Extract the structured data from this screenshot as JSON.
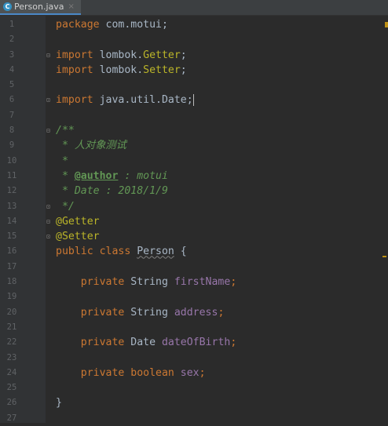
{
  "tab": {
    "filename": "Person.java",
    "icon_letter": "C",
    "close": "×"
  },
  "lines": [
    {
      "n": "1",
      "fold": "",
      "parts": [
        [
          "kw",
          "package "
        ],
        [
          "ident",
          "com.motui;"
        ]
      ]
    },
    {
      "n": "2",
      "fold": "",
      "parts": []
    },
    {
      "n": "3",
      "fold": "⊟",
      "parts": [
        [
          "kw",
          "import "
        ],
        [
          "ident",
          "lombok."
        ],
        [
          "ann",
          "Getter"
        ],
        [
          "ident",
          ";"
        ]
      ]
    },
    {
      "n": "4",
      "fold": "",
      "parts": [
        [
          "kw",
          "import "
        ],
        [
          "ident",
          "lombok."
        ],
        [
          "ann",
          "Setter"
        ],
        [
          "ident",
          ";"
        ]
      ]
    },
    {
      "n": "5",
      "fold": "",
      "parts": []
    },
    {
      "n": "6",
      "fold": "⊡",
      "parts": [
        [
          "kw",
          "import "
        ],
        [
          "ident",
          "java.util.Date"
        ],
        [
          "ident",
          ";"
        ]
      ],
      "caret": true
    },
    {
      "n": "7",
      "fold": "",
      "parts": []
    },
    {
      "n": "8",
      "fold": "⊟",
      "parts": [
        [
          "doc",
          "/**"
        ]
      ]
    },
    {
      "n": "9",
      "fold": "",
      "parts": [
        [
          "doc",
          " * 人对象测试"
        ]
      ]
    },
    {
      "n": "10",
      "fold": "",
      "parts": [
        [
          "doc",
          " *"
        ]
      ]
    },
    {
      "n": "11",
      "fold": "",
      "parts": [
        [
          "doc",
          " * "
        ],
        [
          "tag",
          "@author"
        ],
        [
          "doc",
          " : motui"
        ]
      ]
    },
    {
      "n": "12",
      "fold": "",
      "parts": [
        [
          "doc",
          " * Date : 2018/1/9"
        ]
      ]
    },
    {
      "n": "13",
      "fold": "⊡",
      "parts": [
        [
          "doc",
          " */"
        ]
      ]
    },
    {
      "n": "14",
      "fold": "⊟",
      "parts": [
        [
          "ann",
          "@Getter"
        ]
      ]
    },
    {
      "n": "15",
      "fold": "⊡",
      "parts": [
        [
          "ann",
          "@Setter"
        ]
      ]
    },
    {
      "n": "16",
      "fold": "",
      "parts": [
        [
          "kw",
          "public class "
        ],
        [
          "classref",
          "Person"
        ],
        [
          "ident",
          " {"
        ]
      ]
    },
    {
      "n": "17",
      "fold": "",
      "parts": []
    },
    {
      "n": "18",
      "fold": "",
      "parts": [
        [
          "kw",
          "    private "
        ],
        [
          "ident",
          "String "
        ],
        [
          "field",
          "firstName"
        ],
        [
          "kw",
          ";"
        ]
      ]
    },
    {
      "n": "19",
      "fold": "",
      "parts": []
    },
    {
      "n": "20",
      "fold": "",
      "parts": [
        [
          "kw",
          "    private "
        ],
        [
          "ident",
          "String "
        ],
        [
          "field",
          "address"
        ],
        [
          "kw",
          ";"
        ]
      ]
    },
    {
      "n": "21",
      "fold": "",
      "parts": []
    },
    {
      "n": "22",
      "fold": "",
      "parts": [
        [
          "kw",
          "    private "
        ],
        [
          "ident",
          "Date "
        ],
        [
          "field",
          "dateOfBirth"
        ],
        [
          "kw",
          ";"
        ]
      ]
    },
    {
      "n": "23",
      "fold": "",
      "parts": []
    },
    {
      "n": "24",
      "fold": "",
      "parts": [
        [
          "kw",
          "    private boolean "
        ],
        [
          "field",
          "sex"
        ],
        [
          "kw",
          ";"
        ]
      ]
    },
    {
      "n": "25",
      "fold": "",
      "parts": []
    },
    {
      "n": "26",
      "fold": "",
      "parts": [
        [
          "ident",
          "}"
        ]
      ]
    },
    {
      "n": "27",
      "fold": "",
      "parts": []
    }
  ]
}
